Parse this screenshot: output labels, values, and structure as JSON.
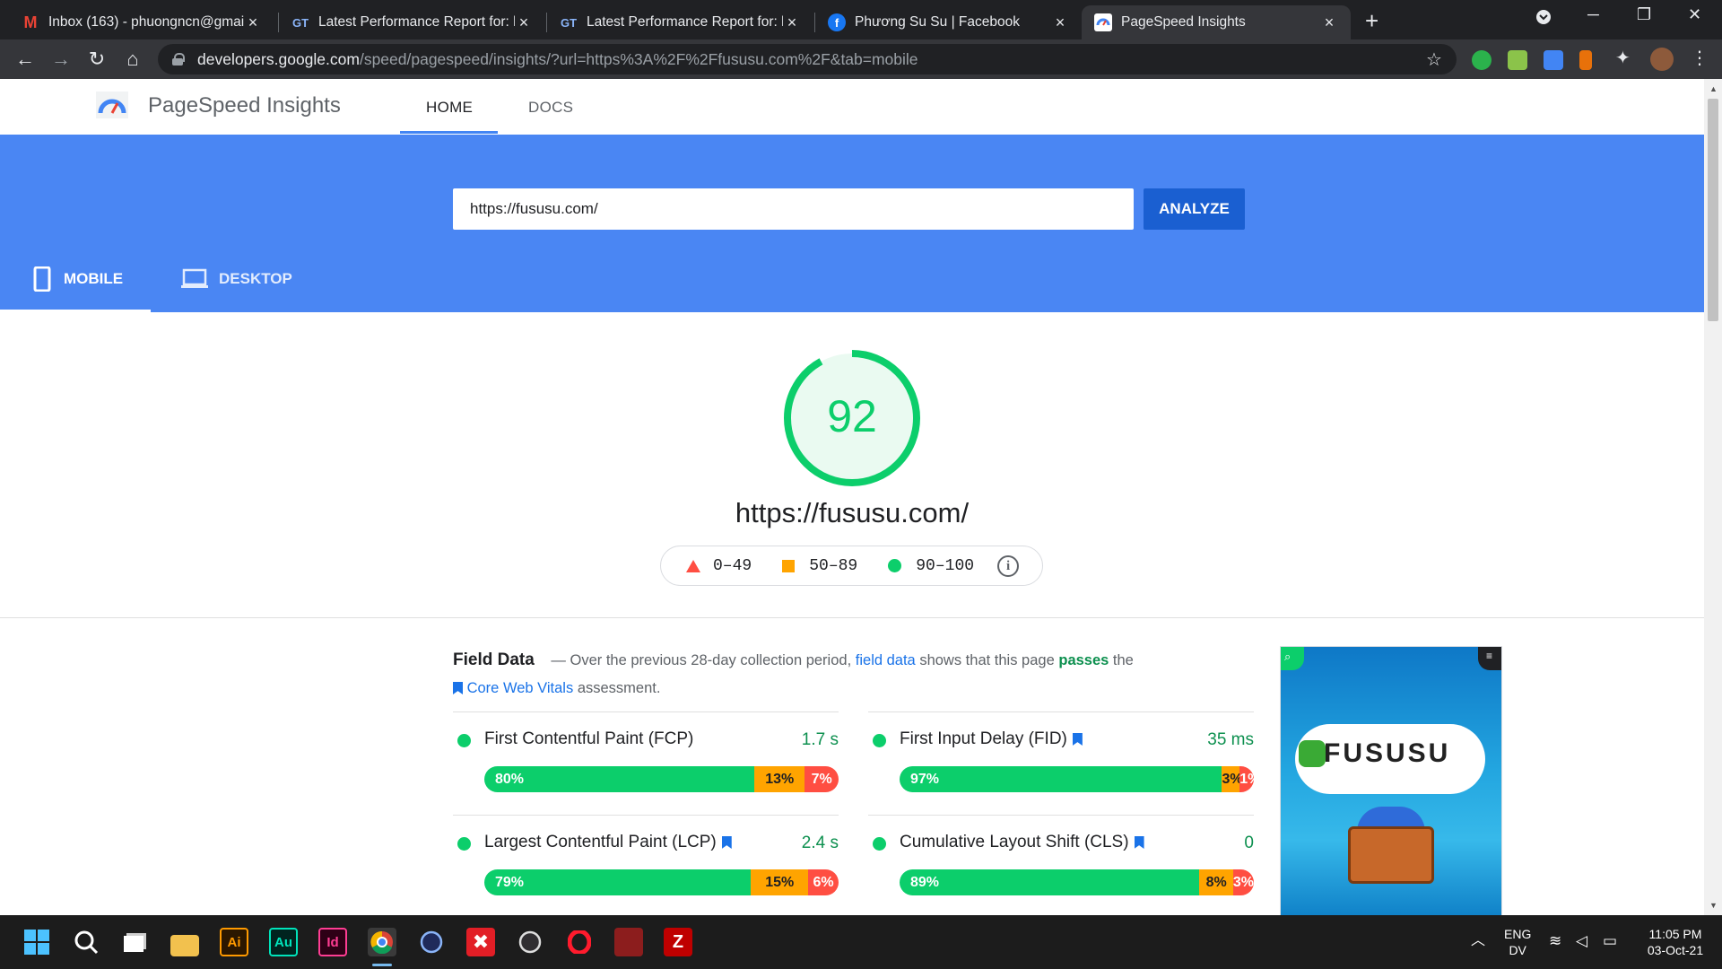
{
  "browser": {
    "tabs": [
      {
        "title": "Inbox (163) - phuongncn@gmail",
        "favicon": "gmail-icon",
        "color": "#ea4335"
      },
      {
        "title": "Latest Performance Report for: ht",
        "favicon": "gtmetrix-icon",
        "color": "#8ab4f8"
      },
      {
        "title": "Latest Performance Report for: ht",
        "favicon": "gtmetrix-icon",
        "color": "#8ab4f8"
      },
      {
        "title": "Phương Su Su | Facebook",
        "favicon": "facebook-icon",
        "color": "#1877f2"
      },
      {
        "title": "PageSpeed Insights",
        "favicon": "pagespeed-icon",
        "color": "#4285f4"
      }
    ],
    "url_host": "developers.google.com",
    "url_path": "/speed/pagespeed/insights/?url=https%3A%2F%2Ffususu.com%2F&tab=mobile"
  },
  "psi": {
    "title": "PageSpeed Insights",
    "nav": {
      "home": "HOME",
      "docs": "DOCS"
    },
    "input_value": "https://fususu.com/",
    "analyze_label": "ANALYZE",
    "mobile_label": "MOBILE",
    "desktop_label": "DESKTOP",
    "score": "92",
    "score_fraction": 0.92,
    "tested_url": "https://fususu.com/",
    "legend": {
      "poor": "0–49",
      "average": "50–89",
      "good": "90–100"
    },
    "colors": {
      "good": "#0cce6b",
      "average": "#ffa400",
      "poor": "#ff4e42",
      "band": "#4a86f3"
    },
    "field": {
      "heading": "Field Data",
      "text1": "— Over the previous 28-day collection period,",
      "link1": "field data",
      "text2": "shows that this page",
      "pass": "passes",
      "text3": "the",
      "link2": "Core Web Vitals",
      "text4": "assessment."
    },
    "metrics": [
      {
        "name": "First Contentful Paint (FCP)",
        "value": "1.7 s",
        "good": "80%",
        "avg": "13%",
        "poor": "7%",
        "g": 80,
        "a": 13,
        "p": 7,
        "core": false
      },
      {
        "name": "First Input Delay (FID)",
        "value": "35 ms",
        "good": "97%",
        "avg": "3%",
        "poor": "1%",
        "g": 97,
        "a": 3,
        "p": 1,
        "core": true
      },
      {
        "name": "Largest Contentful Paint (LCP)",
        "value": "2.4 s",
        "good": "79%",
        "avg": "15%",
        "poor": "6%",
        "g": 79,
        "a": 15,
        "p": 6,
        "core": true
      },
      {
        "name": "Cumulative Layout Shift (CLS)",
        "value": "0",
        "good": "89%",
        "avg": "8%",
        "poor": "3%",
        "g": 89,
        "a": 8,
        "p": 3,
        "core": true
      }
    ],
    "screenshot_brand": "FUSUSU"
  },
  "taskbar": {
    "lang": "ENG",
    "layout": "DV",
    "time": "11:05 PM",
    "date": "03-Oct-21"
  }
}
